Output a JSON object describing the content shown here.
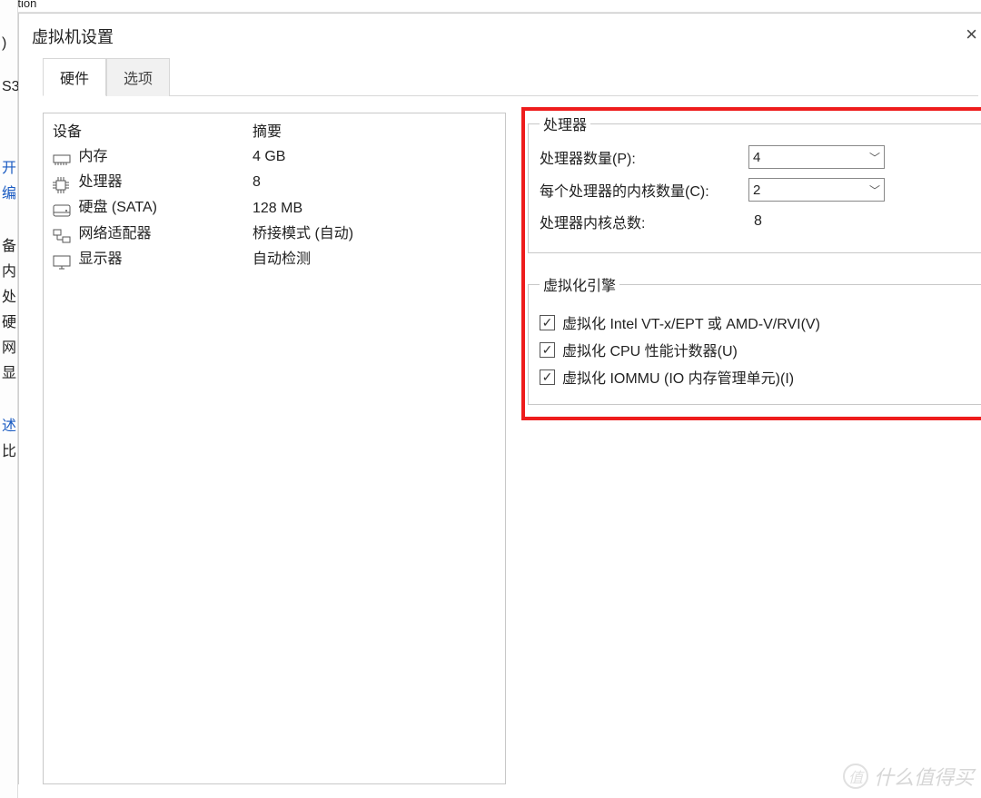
{
  "app_title_fragment": "station",
  "dialog": {
    "title": "虚拟机设置"
  },
  "tabs": {
    "hardware": "硬件",
    "options": "选项"
  },
  "device_table": {
    "col_device": "设备",
    "col_summary": "摘要",
    "rows": [
      {
        "label": "内存",
        "summary": "4 GB"
      },
      {
        "label": "处理器",
        "summary": "8"
      },
      {
        "label": "硬盘 (SATA)",
        "summary": "128 MB"
      },
      {
        "label": "网络适配器",
        "summary": "桥接模式 (自动)"
      },
      {
        "label": "显示器",
        "summary": "自动检测"
      }
    ]
  },
  "processor_group": {
    "legend": "处理器",
    "num_processors_label": "处理器数量(P):",
    "num_processors_value": "4",
    "cores_per_label": "每个处理器的内核数量(C):",
    "cores_per_value": "2",
    "total_cores_label": "处理器内核总数:",
    "total_cores_value": "8"
  },
  "virt_group": {
    "legend": "虚拟化引擎",
    "cb_vt": "虚拟化 Intel VT-x/EPT 或 AMD-V/RVI(V)",
    "cb_perf": "虚拟化 CPU 性能计数器(U)",
    "cb_iommu": "虚拟化 IOMMU (IO 内存管理单元)(I)"
  },
  "sidebar_hints": [
    "开",
    "编",
    "备",
    "内",
    "处",
    "硬",
    "网",
    "显",
    "述",
    "比"
  ],
  "sidebar_fragment_top": ")",
  "sidebar_fragment_s3": "S3",
  "watermark": "什么值得买"
}
